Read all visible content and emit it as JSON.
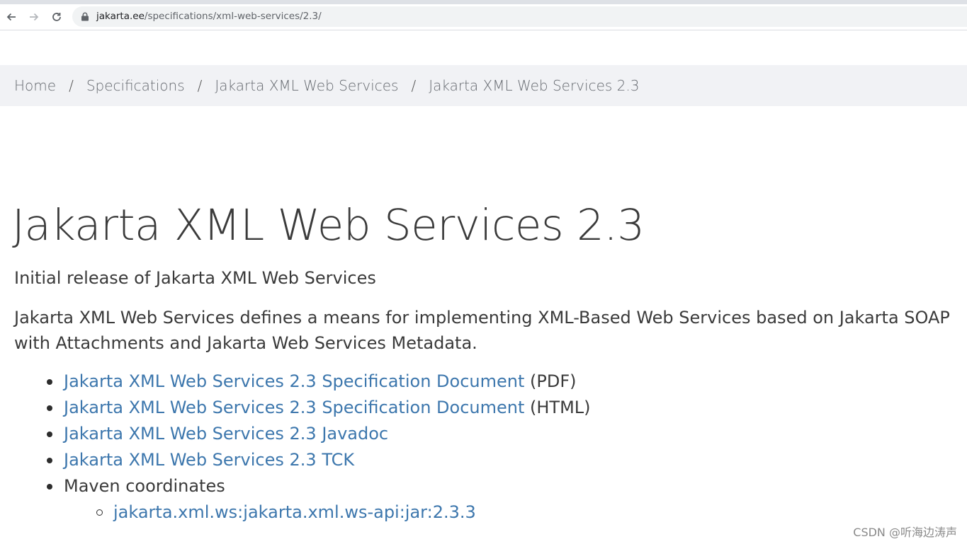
{
  "browser": {
    "url_host": "jakarta.ee",
    "url_path": "/specifications/xml-web-services/2.3/",
    "back_icon": "arrow-left-icon",
    "forward_icon": "arrow-right-icon",
    "reload_icon": "reload-icon",
    "lock_icon": "lock-icon"
  },
  "breadcrumb": {
    "items": [
      {
        "label": "Home"
      },
      {
        "label": "Specifications"
      },
      {
        "label": "Jakarta XML Web Services"
      },
      {
        "label": "Jakarta XML Web Services 2.3"
      }
    ],
    "separator": "/"
  },
  "page": {
    "title": "Jakarta XML Web Services 2.3",
    "subtitle": "Initial release of Jakarta XML Web Services",
    "description": "Jakarta XML Web Services defines a means for implementing XML-Based Web Services based on Jakarta SOAP with Attachments and Jakarta Web Services Metadata."
  },
  "links": {
    "items": [
      {
        "label": "Jakarta XML Web Services 2.3 Specification Document",
        "suffix": "(PDF)"
      },
      {
        "label": "Jakarta XML Web Services 2.3 Specification Document",
        "suffix": "(HTML)"
      },
      {
        "label": "Jakarta XML Web Services 2.3 Javadoc",
        "suffix": ""
      },
      {
        "label": "Jakarta XML Web Services 2.3 TCK",
        "suffix": ""
      }
    ],
    "maven_label": "Maven coordinates",
    "maven_coordinate": "jakarta.xml.ws:jakarta.xml.ws-api:jar:2.3.3"
  },
  "watermark": "CSDN @听海边涛声",
  "colors": {
    "link": "#3d77ad",
    "breadcrumb_bg": "#f1f2f5",
    "text": "#3a3a3a"
  }
}
